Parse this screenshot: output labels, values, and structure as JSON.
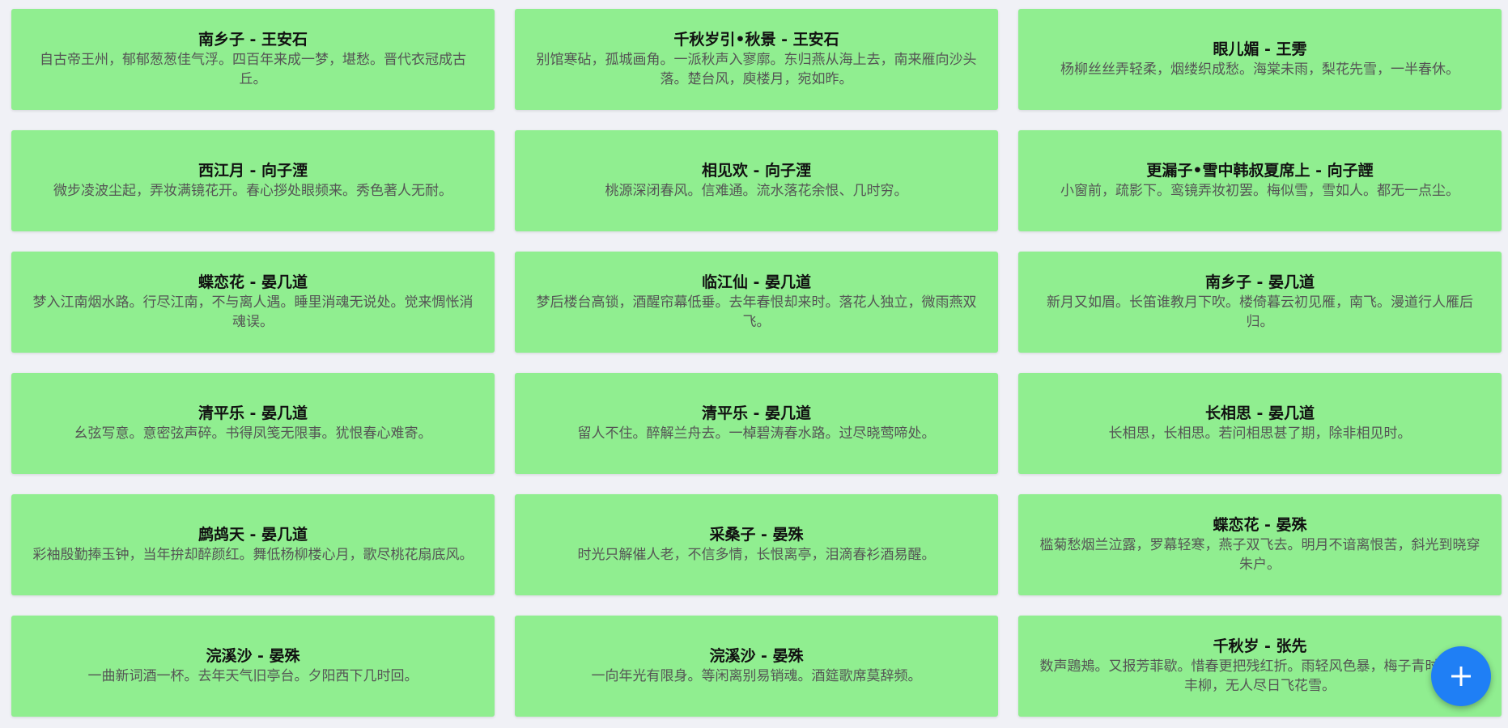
{
  "cards": [
    {
      "title": "南乡子 - 王安石",
      "text": "自古帝王州，郁郁葱葱佳气浮。四百年来成一梦，堪愁。晋代衣冠成古丘。"
    },
    {
      "title": "千秋岁引•秋景 - 王安石",
      "text": "别馆寒砧，孤城画角。一派秋声入寥廓。东归燕从海上去，南来雁向沙头落。楚台风，庾楼月，宛如昨。"
    },
    {
      "title": "眼儿媚 - 王雱",
      "text": "杨柳丝丝弄轻柔，烟缕织成愁。海棠未雨，梨花先雪，一半春休。"
    },
    {
      "title": "西江月 - 向子湮",
      "text": "微步凌波尘起，弄妆满镜花开。春心拶处眼频来。秀色著人无耐。"
    },
    {
      "title": "相见欢 - 向子湮",
      "text": "桃源深闭春风。信难通。流水落花余恨、几时穷。"
    },
    {
      "title": "更漏子•雪中韩叔夏席上 - 向子諲",
      "text": "小窗前，疏影下。鸾镜弄妆初罢。梅似雪，雪如人。都无一点尘。"
    },
    {
      "title": "蝶恋花 - 晏几道",
      "text": "梦入江南烟水路。行尽江南，不与离人遇。睡里消魂无说处。觉来惆怅消魂误。"
    },
    {
      "title": "临江仙 - 晏几道",
      "text": "梦后楼台高锁，酒醒帘幕低垂。去年春恨却来时。落花人独立，微雨燕双飞。"
    },
    {
      "title": "南乡子 - 晏几道",
      "text": "新月又如眉。长笛谁教月下吹。楼倚暮云初见雁，南飞。漫道行人雁后归。"
    },
    {
      "title": "清平乐 - 晏几道",
      "text": "幺弦写意。意密弦声碎。书得凤笺无限事。犹恨春心难寄。"
    },
    {
      "title": "清平乐 - 晏几道",
      "text": "留人不住。醉解兰舟去。一棹碧涛春水路。过尽晓莺啼处。"
    },
    {
      "title": "长相思 - 晏几道",
      "text": "长相思，长相思。若问相思甚了期，除非相见时。"
    },
    {
      "title": "鹧鸪天 - 晏几道",
      "text": "彩袖殷勤捧玉钟，当年拚却醉颜红。舞低杨柳楼心月，歌尽桃花扇底风。"
    },
    {
      "title": "采桑子 - 晏殊",
      "text": "时光只解催人老，不信多情，长恨离亭，泪滴春衫酒易醒。"
    },
    {
      "title": "蝶恋花 - 晏殊",
      "text": "槛菊愁烟兰泣露，罗幕轻寒，燕子双飞去。明月不谙离恨苦，斜光到晓穿朱户。"
    },
    {
      "title": "浣溪沙 - 晏殊",
      "text": "一曲新词酒一杯。去年天气旧亭台。夕阳西下几时回。"
    },
    {
      "title": "浣溪沙 - 晏殊",
      "text": "一向年光有限身。等闲离别易销魂。酒筵歌席莫辞频。"
    },
    {
      "title": "千秋岁 - 张先",
      "text": "数声鶗鴂。又报芳菲歇。惜春更把残红折。雨轻风色暴，梅子青时节。永丰柳，无人尽日飞花雪。"
    }
  ],
  "fab": {
    "icon": "plus-icon",
    "color": "#1f7ff5"
  },
  "colors": {
    "card_background": "#90ee90",
    "page_background": "#f0f1f6"
  }
}
